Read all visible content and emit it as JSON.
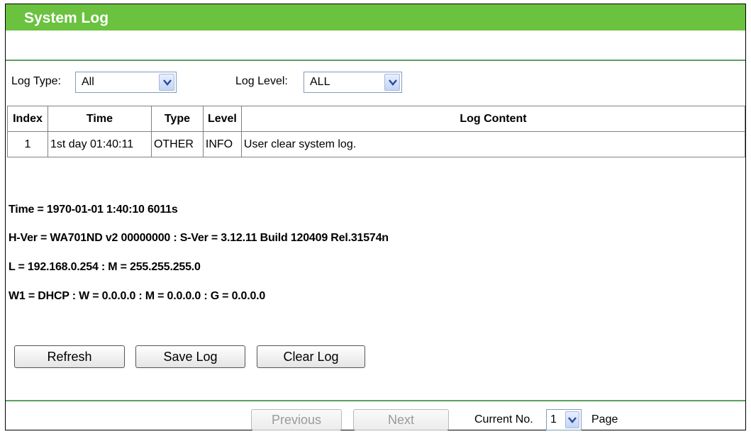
{
  "page": {
    "title": "System Log"
  },
  "filters": {
    "log_type_label": "Log Type:",
    "log_type_value": "All",
    "log_level_label": "Log Level:",
    "log_level_value": "ALL"
  },
  "table": {
    "headers": [
      "Index",
      "Time",
      "Type",
      "Level",
      "Log Content"
    ],
    "rows": [
      [
        "1",
        "1st day 01:40:11",
        "OTHER",
        "INFO",
        "User clear system log."
      ]
    ]
  },
  "system_info": [
    "Time = 1970-01-01 1:40:10 6011s",
    "H-Ver = WA701ND v2 00000000 : S-Ver = 3.12.11 Build 120409 Rel.31574n",
    "L = 192.168.0.254 : M = 255.255.255.0",
    "W1 = DHCP : W = 0.0.0.0 : M = 0.0.0.0 : G = 0.0.0.0"
  ],
  "actions": {
    "refresh": "Refresh",
    "save_log": "Save Log",
    "clear_log": "Clear Log"
  },
  "pagination": {
    "previous": "Previous",
    "next": "Next",
    "current_label": "Current No.",
    "current_value": "1",
    "page_label": "Page"
  },
  "colors": {
    "title_bar": "#6ac23f",
    "divider": "#5aa05d"
  }
}
